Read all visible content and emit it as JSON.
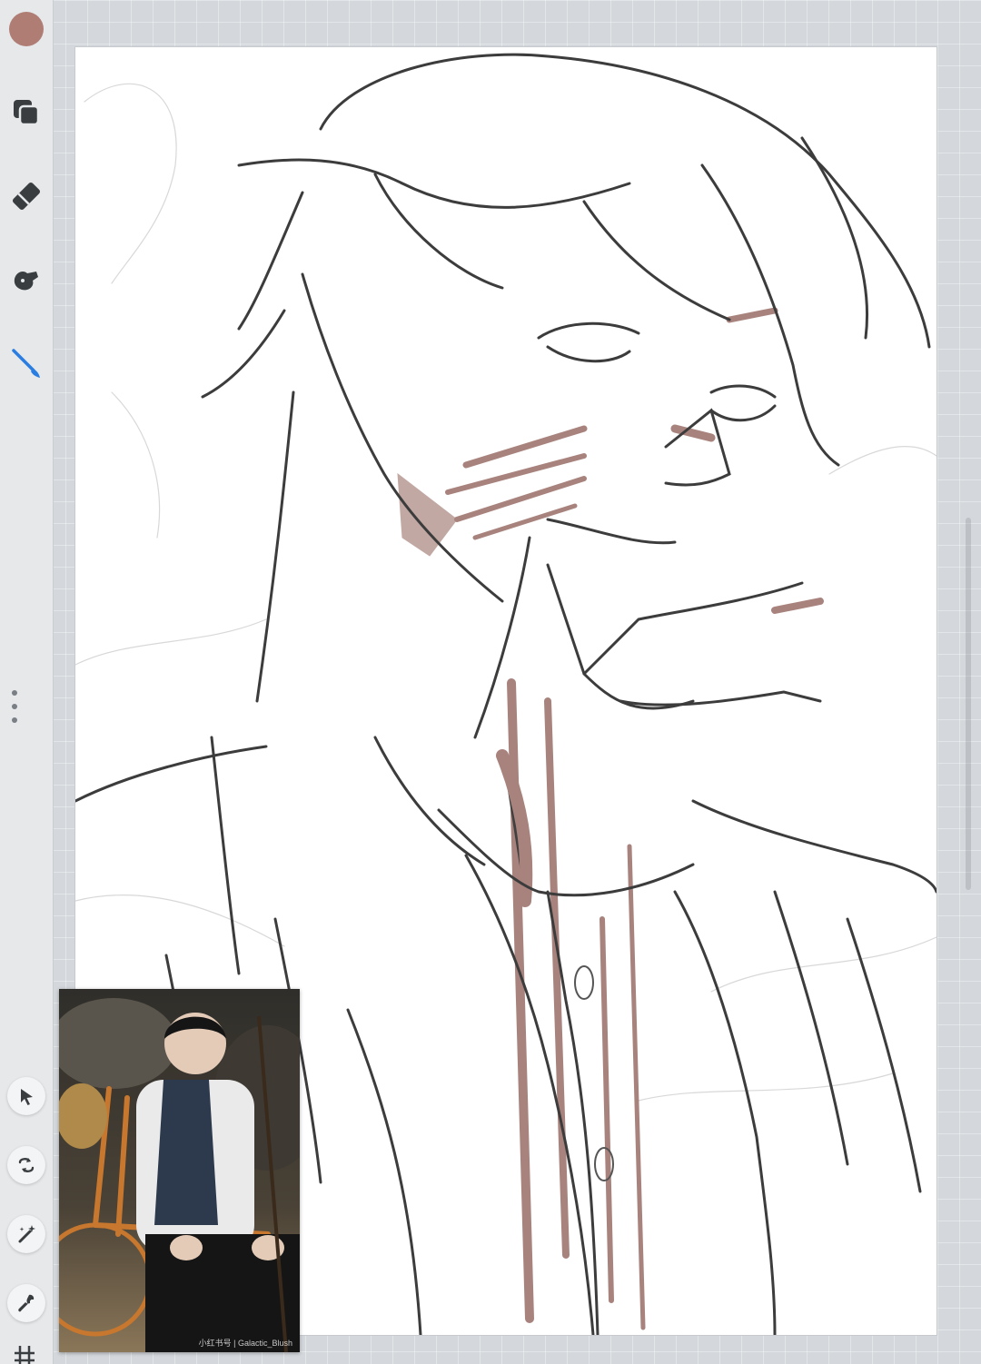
{
  "toolbar": {
    "current_color": "#b07d75",
    "items": [
      {
        "name": "layers",
        "icon": "layers-icon",
        "active": false
      },
      {
        "name": "eraser",
        "icon": "eraser-icon",
        "active": false
      },
      {
        "name": "smudge",
        "icon": "smudge-icon",
        "active": false
      },
      {
        "name": "brush",
        "icon": "brush-icon",
        "active": true
      }
    ],
    "bottom_tools": [
      {
        "name": "select",
        "icon": "arrow-cursor-icon"
      },
      {
        "name": "transform",
        "icon": "transform-icon"
      },
      {
        "name": "adjustments",
        "icon": "magic-wand-icon"
      },
      {
        "name": "actions",
        "icon": "wrench-icon"
      }
    ],
    "accent_color": "#2a7de1"
  },
  "reference": {
    "caption": "小红书号 | Galactic_Blush"
  }
}
